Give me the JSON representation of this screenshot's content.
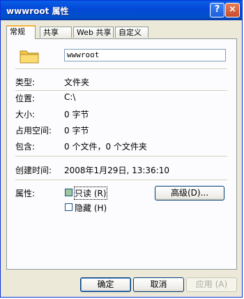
{
  "window": {
    "title": "wwwroot 属性"
  },
  "title_buttons": {
    "help": "?",
    "close": "×"
  },
  "tabs": [
    {
      "label": "常规"
    },
    {
      "label": "共享"
    },
    {
      "label": "Web 共享"
    },
    {
      "label": "自定义"
    }
  ],
  "general": {
    "folder_name": "wwwroot",
    "type_label": "类型:",
    "type_value": "文件夹",
    "location_label": "位置:",
    "location_value": "C:\\",
    "size_label": "大小:",
    "size_value": "0 字节",
    "size_on_disk_label": "占用空间:",
    "size_on_disk_value": "0 字节",
    "contains_label": "包含:",
    "contains_value": "0 个文件，0 个文件夹",
    "created_label": "创建时间:",
    "created_value": "2008年1月29日, 13:36:10",
    "attributes_label": "属性:",
    "readonly_label": "只读 (R)",
    "readonly_checked": true,
    "hidden_label": "隐藏 (H)",
    "hidden_checked": false,
    "advanced_button": "高级(D)..."
  },
  "footer": {
    "ok": "确定",
    "cancel": "取消",
    "apply": "应用 (A)"
  }
}
